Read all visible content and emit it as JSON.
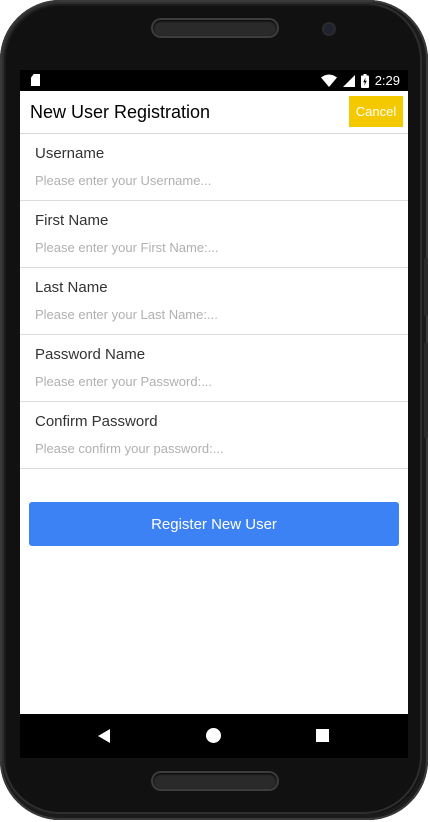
{
  "status_bar": {
    "time": "2:29",
    "icons": [
      "sd-card-icon",
      "wifi-icon",
      "signal-icon",
      "battery-icon"
    ]
  },
  "header": {
    "title": "New User Registration",
    "cancel_label": "Cancel",
    "cancel_color": "#f5c900"
  },
  "form": {
    "fields": [
      {
        "label": "Username",
        "placeholder": "Please enter your Username...",
        "value": ""
      },
      {
        "label": "First Name",
        "placeholder": "Please enter your First Name:...",
        "value": ""
      },
      {
        "label": "Last Name",
        "placeholder": "Please enter your Last Name:...",
        "value": ""
      },
      {
        "label": "Password Name",
        "placeholder": "Please enter your Password:...",
        "value": ""
      },
      {
        "label": "Confirm Password",
        "placeholder": "Please confirm your password:...",
        "value": ""
      }
    ],
    "register_label": "Register New User",
    "register_color": "#3d82f5"
  },
  "nav_bar": {
    "icons": [
      "back-icon",
      "home-icon",
      "recents-icon"
    ]
  }
}
